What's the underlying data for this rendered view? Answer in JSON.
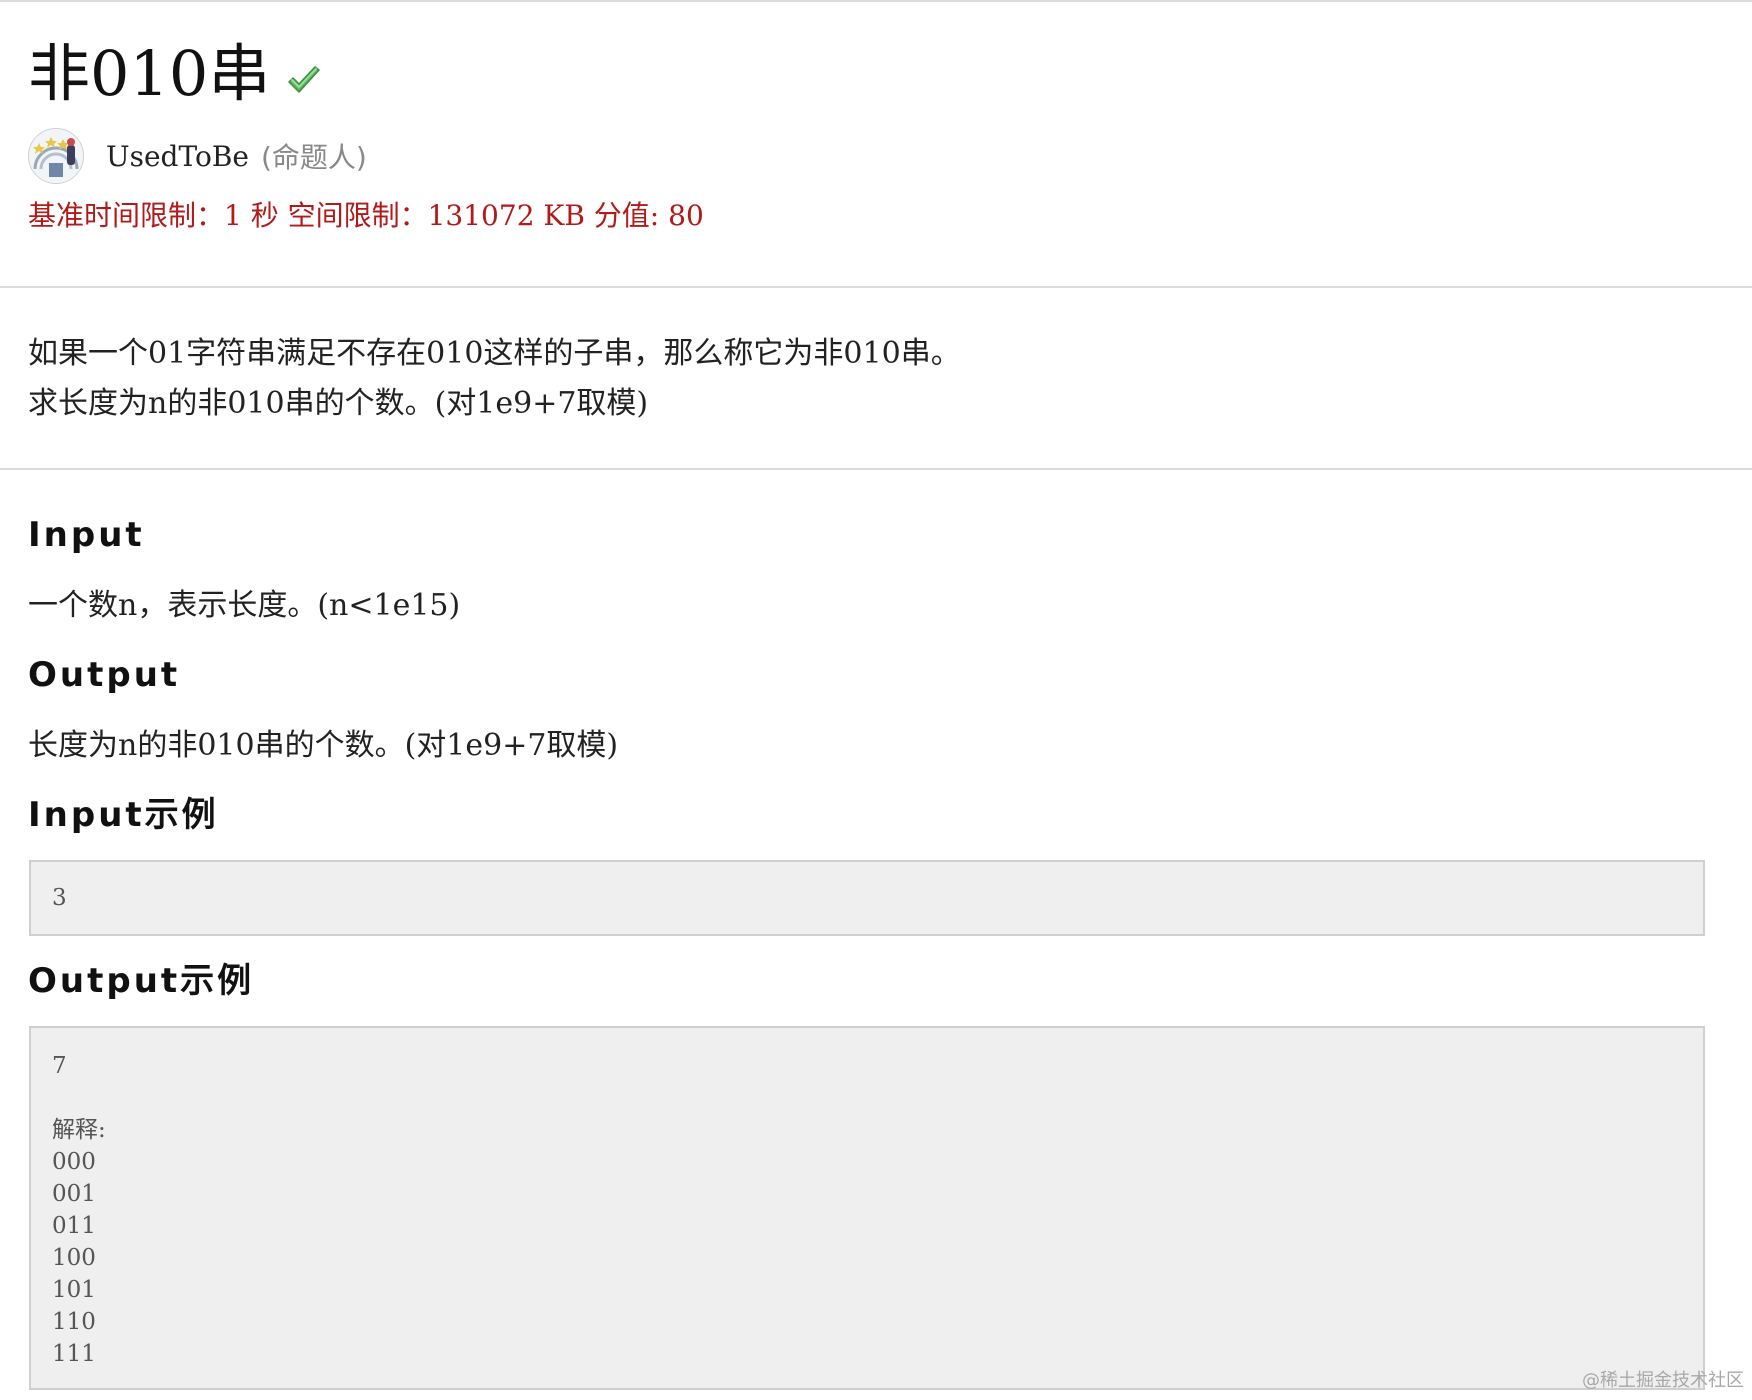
{
  "problem": {
    "title": "非010串",
    "solved_icon": "check-icon",
    "author": {
      "name": "UsedToBe",
      "role": "(命题人)"
    },
    "limits": "基准时间限制：1 秒 空间限制：131072 KB 分值: 80"
  },
  "description": {
    "lines": [
      "如果一个01字符串满足不存在010这样的子串，那么称它为非010串。",
      "求长度为n的非010串的个数。(对1e9+7取模)"
    ]
  },
  "sections": {
    "input_heading": "Input",
    "input_text": "一个数n，表示长度。(n<1e15)",
    "output_heading": "Output",
    "output_text": "长度为n的非010串的个数。(对1e9+7取模)",
    "input_example_heading": "Input示例",
    "input_example_value": "3",
    "output_example_heading": "Output示例",
    "output_example_lines": [
      "7",
      "",
      "解释:",
      "000",
      "001",
      "011",
      "100",
      "101",
      "110",
      "111"
    ]
  },
  "watermark": "@稀土掘金技术社区",
  "colors": {
    "limits_red": "#b21a1a",
    "sample_bg": "#efefef",
    "divider": "#dcdcdc",
    "check_green": "#5cb85c"
  }
}
